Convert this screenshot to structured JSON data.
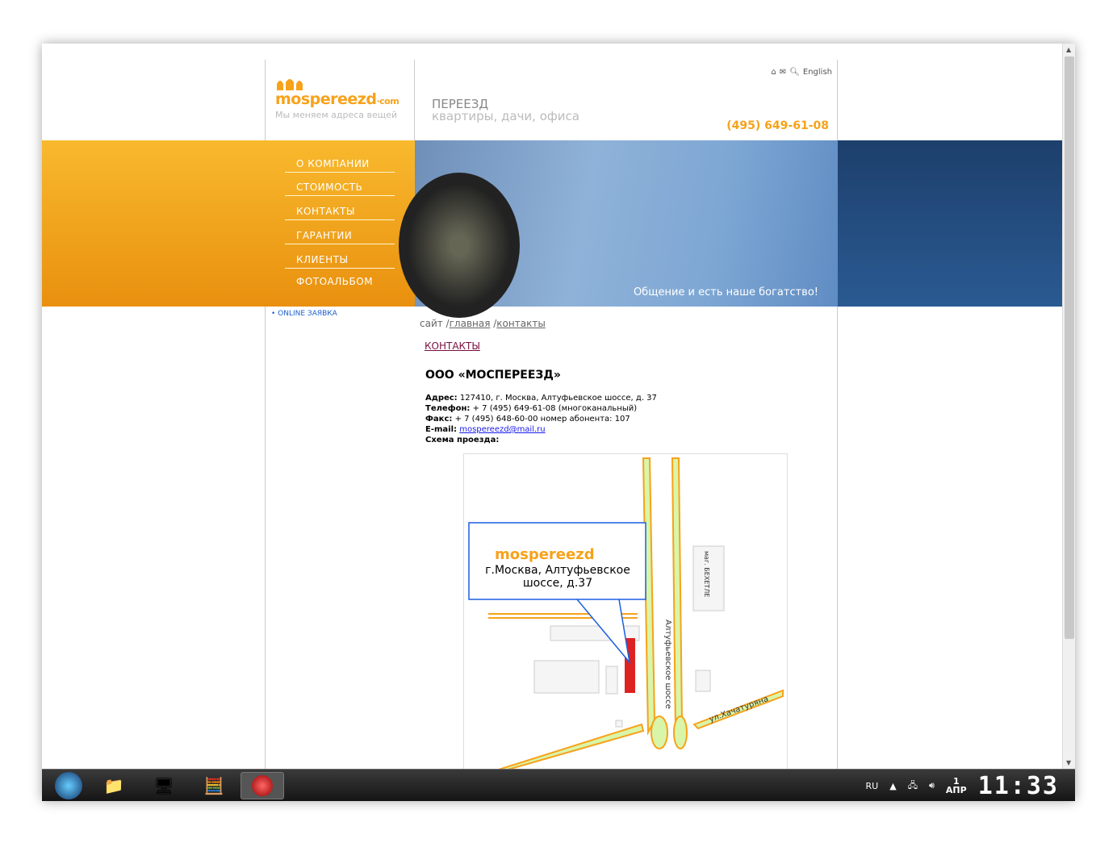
{
  "logo": {
    "brand": "mospereezd",
    "brand_suffix": "·com",
    "tagline": "Мы меняем адреса вещей"
  },
  "header": {
    "line1": "ПЕРЕЕЗД",
    "line2": "квартиры, дачи, офиса",
    "phone": "(495) 649-61-08",
    "lang": "English"
  },
  "menu": [
    "О КОМПАНИИ",
    "СТОИМОСТЬ",
    "КОНТАКТЫ",
    "ГАРАНТИИ",
    "КЛИЕНТЫ",
    "ФОТОАЛЬБОМ"
  ],
  "banner_caption": "Общение и есть наше богатство!",
  "side": {
    "online": "ONLINE ЗАЯВКА"
  },
  "breadcrumb": {
    "root": "сайт /",
    "home": "главная",
    "sep": " /",
    "current": "контакты"
  },
  "page_title": "КОНТАКТЫ",
  "org": "ООО «МОСПЕРЕЕЗД»",
  "info": {
    "addr_label": "Адрес:",
    "addr": " 127410, г. Москва, Алтуфьевское шоссе, д. 37",
    "tel_label": "Телефон:",
    "tel": " + 7 (495) 649-61-08 (многоканальный)",
    "fax_label": "Факс:",
    "fax": " + 7 (495) 648-60-00 номер абонента: 107",
    "email_label": "E-mail:",
    "email": "mospereezd@mail.ru",
    "scheme_label": "Схема проезда:"
  },
  "map": {
    "callout": "г.Москва, Алтуфьевское шоссе, д.37",
    "road1": "Алтуфьевское шоссе",
    "road2": "ул.Хачатуряна",
    "shop": "маг. БЕХЕТЛЕ"
  },
  "taskbar": {
    "lang": "RU",
    "day": "1",
    "month": "АПР",
    "time": "11:33"
  }
}
